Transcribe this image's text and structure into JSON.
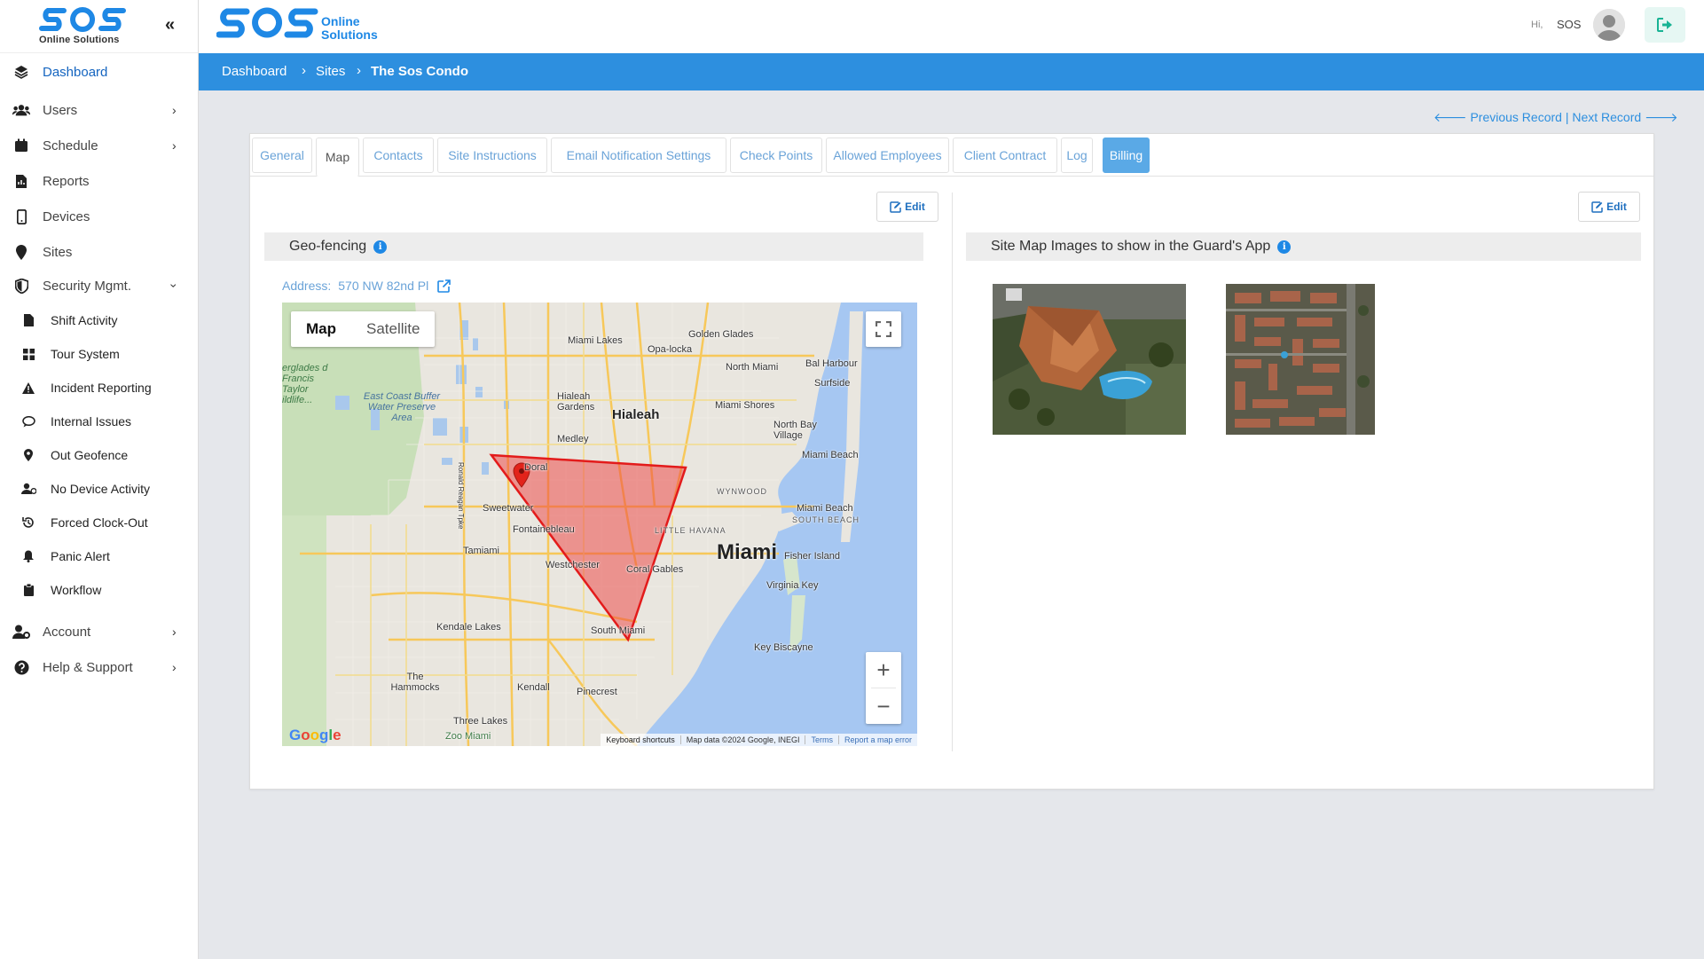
{
  "brand": {
    "logo_text": "SOS",
    "sidebar_subtitle": "Online Solutions",
    "header_line1": "Online",
    "header_line2": "Solutions",
    "accent": "#2d8fdf"
  },
  "sidebar": {
    "items": [
      {
        "label": "Dashboard",
        "icon": "layers-icon"
      },
      {
        "label": "Users",
        "icon": "users-icon"
      },
      {
        "label": "Schedule",
        "icon": "calendar-icon"
      },
      {
        "label": "Reports",
        "icon": "file-report-icon"
      },
      {
        "label": "Devices",
        "icon": "mobile-icon"
      },
      {
        "label": "Sites",
        "icon": "map-pin-icon"
      },
      {
        "label": "Security Mgmt.",
        "icon": "shield-icon"
      }
    ],
    "security_sub": [
      {
        "label": "Shift Activity",
        "icon": "document-icon"
      },
      {
        "label": "Tour System",
        "icon": "grid-icon"
      },
      {
        "label": "Incident Reporting",
        "icon": "warning-icon"
      },
      {
        "label": "Internal Issues",
        "icon": "chat-bubble-icon"
      },
      {
        "label": "Out Geofence",
        "icon": "location-icon"
      },
      {
        "label": "No Device Activity",
        "icon": "user-off-icon"
      },
      {
        "label": "Forced Clock-Out",
        "icon": "history-icon"
      },
      {
        "label": "Panic Alert",
        "icon": "bell-icon"
      },
      {
        "label": "Workflow",
        "icon": "clipboard-icon"
      }
    ],
    "bottom": [
      {
        "label": "Account",
        "icon": "user-gear-icon"
      },
      {
        "label": "Help & Support",
        "icon": "question-circle-icon"
      }
    ]
  },
  "header": {
    "greeting": "Hi,",
    "username": "SOS"
  },
  "breadcrumb": [
    "Dashboard",
    "Sites",
    "The Sos Condo"
  ],
  "record_nav": {
    "previous": "Previous Record",
    "separator": "|",
    "next": "Next Record"
  },
  "tabs": [
    "General",
    "Map",
    "Contacts",
    "Site Instructions",
    "Email Notification Settings",
    "Check Points",
    "Allowed Employees",
    "Client Contract",
    "Log",
    "Billing"
  ],
  "active_tab": "Map",
  "geofence": {
    "edit_label": "Edit",
    "title": "Geo-fencing",
    "address_label": "Address:",
    "address_value": "570 NW 82nd Pl"
  },
  "map": {
    "type_map": "Map",
    "type_satellite": "Satellite",
    "zoom_in": "+",
    "zoom_out": "−",
    "google": "Google",
    "footer": [
      "Keyboard shortcuts",
      "Map data ©2024 Google, INEGI",
      "Terms",
      "Report a map error"
    ],
    "labels": {
      "miami": "Miami",
      "hialeah": "Hialeah",
      "miami_lakes": "Miami Lakes",
      "opa_locka": "Opa-locka",
      "golden_glades": "Golden Glades",
      "north_miami": "North Miami",
      "bal_harbour": "Bal Harbour",
      "surfside": "Surfside",
      "miami_shores": "Miami Shores",
      "north_bay_village": "North Bay Village",
      "miami_beach": "Miami Beach",
      "miami_beach_2": "Miami Beach",
      "south_beach": "SOUTH BEACH",
      "hialeah_gardens": "Hialeah Gardens",
      "medley": "Medley",
      "doral": "Doral",
      "sweetwater": "Sweetwater",
      "fontainebleau": "Fontainebleau",
      "tamiami": "Tamiami",
      "westchester": "Westchester",
      "coral_gables": "Coral Gables",
      "little_havana": "LITTLE HAVANA",
      "wynwood": "WYNWOOD",
      "fisher_island": "Fisher Island",
      "virginia_key": "Virginia Key",
      "key_biscayne": "Key Biscayne",
      "kendale_lakes": "Kendale Lakes",
      "south_miami": "South Miami",
      "the_hammocks": "The Hammocks",
      "kendall": "Kendall",
      "pinecrest": "Pinecrest",
      "three_lakes": "Three Lakes",
      "zoo_miami": "Zoo Miami",
      "east_coast_buffer": "East Coast Buffer Water Preserve Area",
      "everglades": "erglades d Francis Taylor ildlife...",
      "ronald_reagan": "Ronald Reagan Tpke"
    }
  },
  "site_images": {
    "edit_label": "Edit",
    "title": "Site Map Images to show in the Guard's App"
  }
}
